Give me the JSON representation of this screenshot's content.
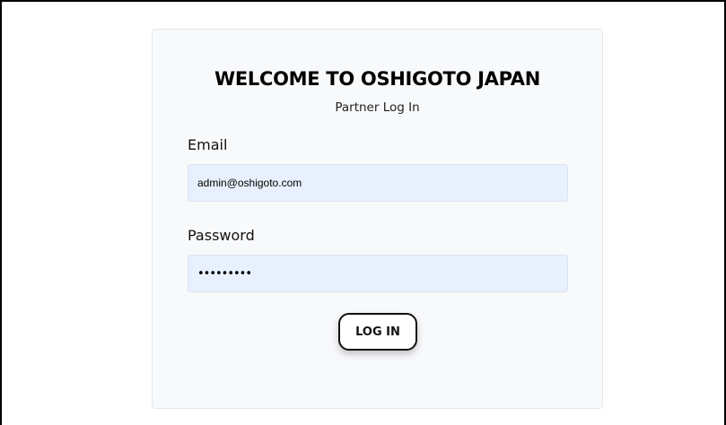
{
  "login": {
    "title": "WELCOME TO OSHIGOTO JAPAN",
    "subtitle": "Partner Log In",
    "email_label": "Email",
    "email_value": "admin@oshigoto.com",
    "password_label": "Password",
    "password_value": "•••••••••",
    "button_label": "LOG IN"
  },
  "colors": {
    "input_autofill_bg": "#e8f0fe",
    "card_bg": "#f8f9fb",
    "button_border": "#111111"
  }
}
